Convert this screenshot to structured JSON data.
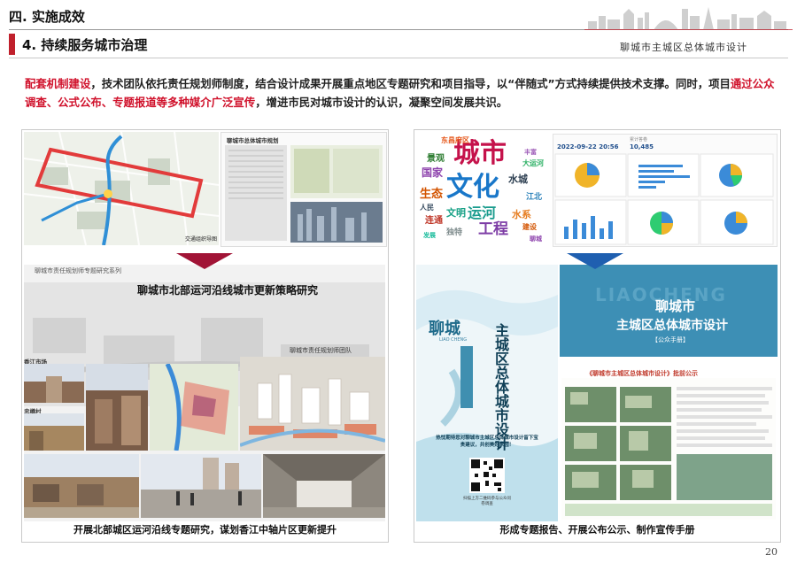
{
  "header": {
    "section": "四. 实施成效",
    "subsection": "4. 持续服务城市治理",
    "project": "聊城市主城区总体城市设计"
  },
  "intro": {
    "p1": "配套机制建设",
    "p2": "，技术团队依托责任规划师制度，结合设计成果开展重点地区专题研究和项目指导，以“伴随式”方式持续提供技术支撑。同时，项目",
    "p3": "通过公众调查、公式公布、专题报道等多种媒介广泛宣传",
    "p4": "，增进市民对城市设计的认识，凝聚空间发展共识。"
  },
  "left": {
    "map_label": "交通组织导图",
    "doc_title": "聊城市总体城市规划",
    "series_label": "聊城市责任规划师专题研究系列",
    "study_title": "聊城市北部运河沿线城市更新策略研究",
    "team": "聊城市责任规划师团队",
    "site1": "香江市场",
    "site2": "忠樽村",
    "caption": "开展北部城区运河沿线专题研究，谋划香江中轴片区更新提升"
  },
  "right": {
    "wordcloud": [
      "城市",
      "文化",
      "运河",
      "工程",
      "东昌府区",
      "景观",
      "国家",
      "生态",
      "水城",
      "文明",
      "连通",
      "独特",
      "江北",
      "水系",
      "大运河",
      "丰富",
      "人民",
      "建设",
      "发展",
      "聊城"
    ],
    "survey_date": "2022-09-22 20:56",
    "survey_count": "10,485",
    "survey_count_label": "累计答卷",
    "brochure_label": "公众宣传手册",
    "brochure_city": "聊城",
    "brochure_title": "主城区总体城市设计",
    "brochure_pin": "LIAO CHENG",
    "brochure_invite": "热忱期待您对聊城市主城区总体城市设计留下宝贵建议，共创美好家园！",
    "qr_note": "扫描上方二维码参与公众问卷调查",
    "poster_bg": "LIAOCHENG",
    "poster_city": "聊城市",
    "poster_title": "主城区总体城市设计",
    "poster_tag": "【公众手册】",
    "notice_title": "《聊城市主城区总体城市设计》批前公示",
    "caption": "形成专题报告、开展公布公示、制作宣传手册"
  },
  "page_number": "20",
  "colors": {
    "accent_red": "#d0112b",
    "arrow_left": "#a11436",
    "arrow_right": "#1f5fb0"
  }
}
